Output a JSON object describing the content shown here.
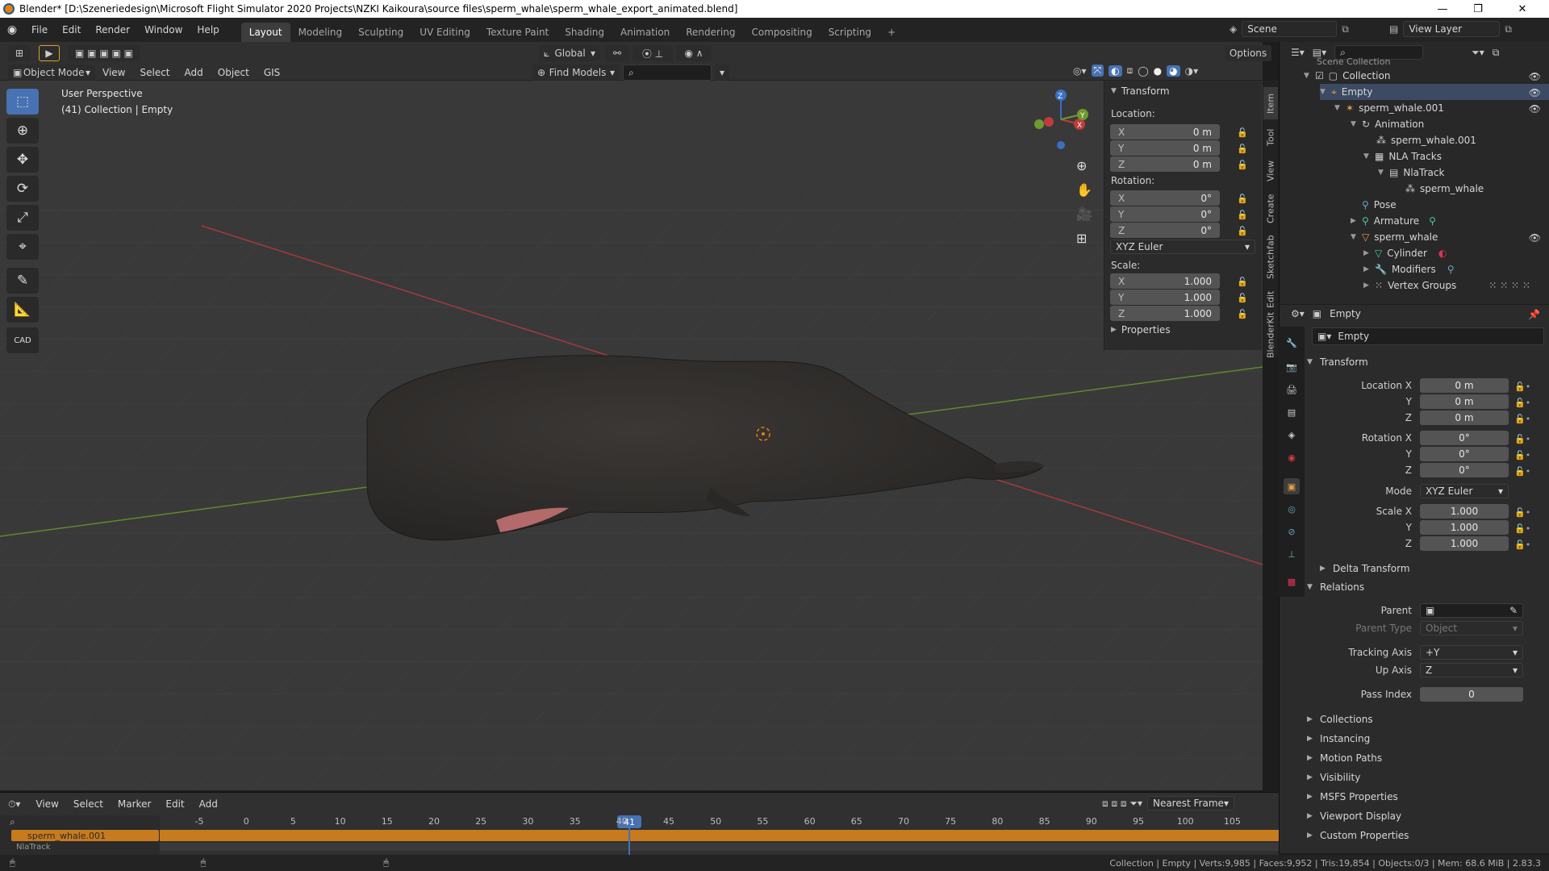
{
  "window": {
    "title": "Blender* [D:\\Szeneriedesign\\Microsoft Flight Simulator 2020 Projects\\NZKI Kaikoura\\source files\\sperm_whale\\sperm_whale_export_animated.blend]"
  },
  "menu": [
    "File",
    "Edit",
    "Render",
    "Window",
    "Help"
  ],
  "workspaces": [
    "Layout",
    "Modeling",
    "Sculpting",
    "UV Editing",
    "Texture Paint",
    "Shading",
    "Animation",
    "Rendering",
    "Compositing",
    "Scripting",
    "+"
  ],
  "scene": {
    "name": "Scene",
    "view_layer": "View Layer"
  },
  "header": {
    "mode": "Object Mode",
    "menus": [
      "View",
      "Select",
      "Add",
      "Object",
      "GIS"
    ],
    "transform_orientation": "Global",
    "find_models": "Find Models",
    "options": "Options"
  },
  "viewport": {
    "perspective": "User Perspective",
    "context": "(41) Collection | Empty"
  },
  "npanel": {
    "transform_title": "Transform",
    "location_label": "Location:",
    "location": [
      {
        "axis": "X",
        "value": "0 m"
      },
      {
        "axis": "Y",
        "value": "0 m"
      },
      {
        "axis": "Z",
        "value": "0 m"
      }
    ],
    "rotation_label": "Rotation:",
    "rotation": [
      {
        "axis": "X",
        "value": "0°"
      },
      {
        "axis": "Y",
        "value": "0°"
      },
      {
        "axis": "Z",
        "value": "0°"
      }
    ],
    "rotation_mode": "XYZ Euler",
    "scale_label": "Scale:",
    "scale": [
      {
        "axis": "X",
        "value": "1.000"
      },
      {
        "axis": "Y",
        "value": "1.000"
      },
      {
        "axis": "Z",
        "value": "1.000"
      }
    ],
    "properties_title": "Properties",
    "tabs": [
      "Item",
      "Tool",
      "View",
      "Create",
      "Sketchfab",
      "Edit",
      "BlenderKit"
    ]
  },
  "outliner": {
    "rows": [
      "Scene Collection",
      "Collection",
      "Empty",
      "sperm_whale.001",
      "Animation",
      "sperm_whale.001",
      "NLA Tracks",
      "NlaTrack",
      "sperm_whale",
      "Pose",
      "Armature",
      "sperm_whale",
      "Cylinder",
      "Modifiers",
      "Vertex Groups"
    ]
  },
  "properties": {
    "object_name": "Empty",
    "datablock": "Empty",
    "transform_title": "Transform",
    "labels": {
      "loc_x": "Location X",
      "y": "Y",
      "z": "Z",
      "rot_x": "Rotation X",
      "mode": "Mode",
      "scale_x": "Scale X"
    },
    "location": [
      "0 m",
      "0 m",
      "0 m"
    ],
    "rotation": [
      "0°",
      "0°",
      "0°"
    ],
    "mode": "XYZ Euler",
    "scale": [
      "1.000",
      "1.000",
      "1.000"
    ],
    "delta_transform": "Delta Transform",
    "relations_title": "Relations",
    "parent_label": "Parent",
    "parent_type_label": "Parent Type",
    "parent_type": "Object",
    "tracking_axis_label": "Tracking Axis",
    "tracking_axis": "+Y",
    "up_axis_label": "Up Axis",
    "up_axis": "Z",
    "pass_index_label": "Pass Index",
    "pass_index": "0",
    "sections": [
      "Collections",
      "Instancing",
      "Motion Paths",
      "Visibility",
      "MSFS Properties",
      "Viewport Display",
      "Custom Properties"
    ]
  },
  "timeline": {
    "menus": [
      "View",
      "Select",
      "Marker",
      "Edit",
      "Add"
    ],
    "snap": "Nearest Frame",
    "current_frame": "41",
    "ticks": [
      "-5",
      "0",
      "5",
      "10",
      "15",
      "20",
      "25",
      "30",
      "35",
      "40",
      "45",
      "50",
      "55",
      "60",
      "65",
      "70",
      "75",
      "80",
      "85",
      "90",
      "95",
      "100",
      "105"
    ],
    "track_name": "sperm_whale.001",
    "nla_label": "NlaTrack"
  },
  "status": {
    "text": "Collection | Empty | Verts:9,985 | Faces:9,952 | Tris:19,854 | Objects:0/3 | Mem: 68.6 MiB | 2.83.3"
  },
  "colors": {
    "accent": "#4772b3",
    "orange": "#e87d0d",
    "timeline_bar": "#c87a1e",
    "axis_x": "#c03b3b",
    "axis_y": "#6f9a2e",
    "axis_z": "#3a6fc3"
  }
}
